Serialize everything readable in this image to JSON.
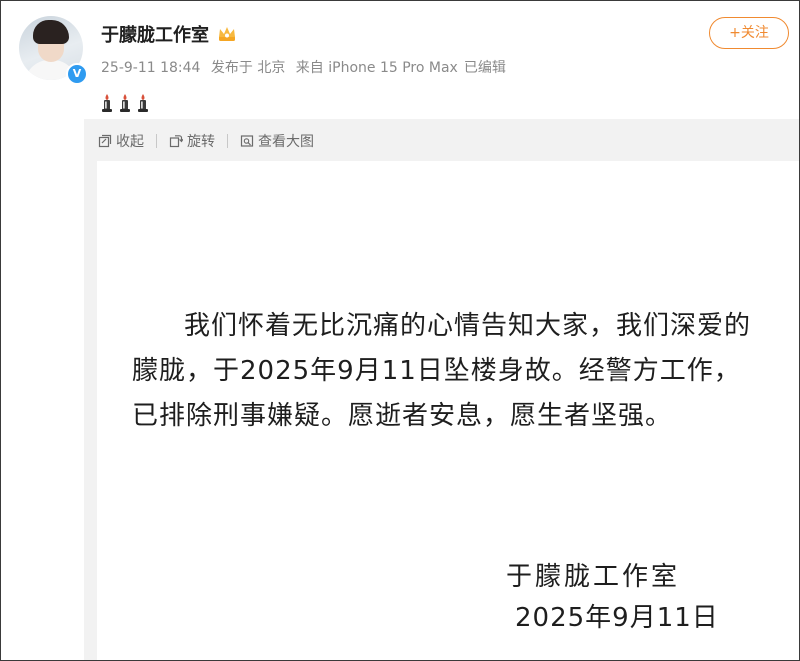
{
  "post": {
    "author": "于朦胧工作室",
    "verified_mark": "V",
    "timestamp": "25-9-11 18:44",
    "location": "发布于 北京",
    "source": "来自 iPhone 15 Pro Max",
    "edited": "已编辑",
    "follow_label": "+关注",
    "icons": {
      "crown": "crown-icon",
      "candle": "candle-icon",
      "collapse": "collapse-icon",
      "rotate": "rotate-icon",
      "view_large": "view-large-icon"
    },
    "colors": {
      "follow_accent": "#f08a30",
      "verified_badge": "#2f9bf0",
      "meta_text": "#8a8a8a"
    }
  },
  "media": {
    "toolbar": {
      "collapse_label": "收起",
      "rotate_label": "旋转",
      "view_large_label": "查看大图"
    },
    "notice": {
      "body": "我们怀着无比沉痛的心情告知大家，我们深爱的朦胧，于2025年9月11日坠楼身故。经警方工作，已排除刑事嫌疑。愿逝者安息，愿生者坚强。",
      "signature": "于朦胧工作室",
      "date": "2025年9月11日"
    }
  }
}
